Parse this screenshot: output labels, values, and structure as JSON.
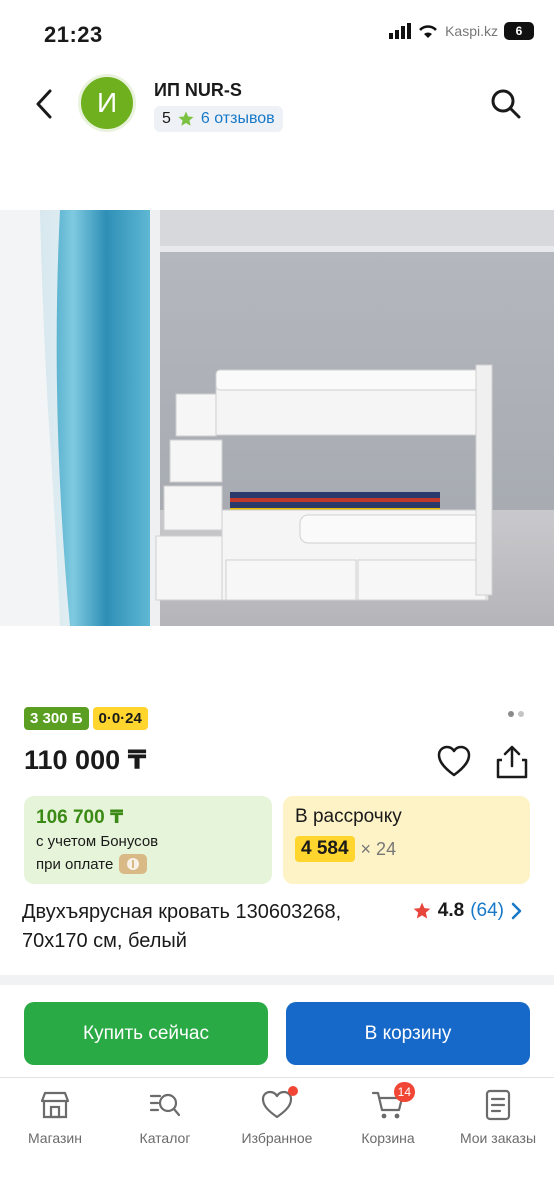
{
  "status": {
    "time": "21:23",
    "watermark": "Kaspi.kz",
    "battery": "6"
  },
  "header": {
    "seller_initial": "И",
    "seller_name": "ИП NUR-S",
    "rating": "5",
    "reviews": "6 отзывов"
  },
  "product": {
    "bonus_badge": "3 300 Б",
    "installment_badge": "0·0·24",
    "price": "110 000 ₸",
    "bonus_price": "106 700 ₸",
    "bonus_note_1": "с учетом Бонусов",
    "bonus_note_2": "при оплате",
    "installment_title": "В рассрочку",
    "installment_monthly": "4 584",
    "installment_term": "× 24",
    "title": "Двухъярусная кровать 130603268, 70х170 см, белый",
    "rating_score": "4.8",
    "rating_count": "(64)"
  },
  "actions": {
    "buy_now": "Купить сейчас",
    "add_to_cart": "В корзину"
  },
  "tabbar": {
    "shop": "Магазин",
    "catalog": "Каталог",
    "favorites": "Избранное",
    "cart": "Корзина",
    "cart_count": "14",
    "orders": "Мои заказы"
  },
  "colors": {
    "primary_green": "#2aaa45",
    "primary_blue": "#1769c9",
    "accent_yellow": "#ffd52e",
    "bonus_green": "#5a9e22",
    "badge_red": "#f14635"
  }
}
